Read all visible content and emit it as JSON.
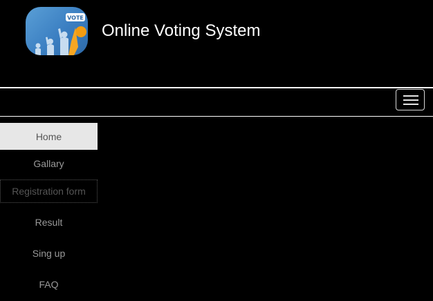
{
  "header": {
    "title": "Online Voting System",
    "logo_badge": "VOTE"
  },
  "navbar": {
    "toggle_icon": "hamburger-menu-icon"
  },
  "sidebar": {
    "items": [
      {
        "label": "Home",
        "active": true
      },
      {
        "label": "Gallary",
        "active": false
      },
      {
        "label": "Registration form",
        "active": false
      },
      {
        "label": "Result",
        "active": false
      },
      {
        "label": "Sing up",
        "active": false
      },
      {
        "label": "FAQ",
        "active": false
      }
    ]
  },
  "colors": {
    "background": "#000000",
    "title_text": "#ffffff",
    "active_item_bg": "#e7e7e7",
    "nav_text": "#9a9a9a",
    "logo_blue": "#3b7fc2",
    "logo_accent": "#f39c12"
  }
}
